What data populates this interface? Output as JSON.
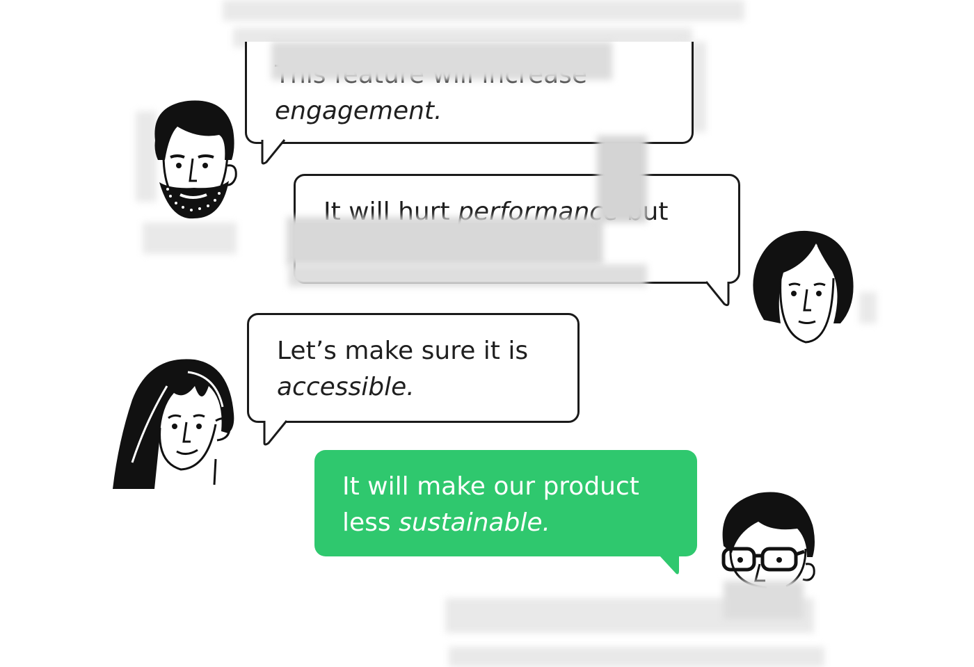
{
  "messages": [
    {
      "id": "m1",
      "line1": "This feature will increase",
      "line2_italic": "engagement."
    },
    {
      "id": "m2",
      "line1_plain": "It will hurt ",
      "line1_italic": "performance",
      "line1_end": " but"
    },
    {
      "id": "m3",
      "line1": "Let’s make sure it is",
      "line2_italic": "accessible."
    },
    {
      "id": "m4",
      "line1": "It will make our product",
      "line2_plain": "less ",
      "line2_italic": "sustainable."
    }
  ],
  "colors": {
    "accent_green": "#2fc86e",
    "outline": "#1a1a1a",
    "background": "#ffffff"
  },
  "avatars": [
    "bearded-man-icon",
    "short-hair-woman-icon",
    "long-hair-woman-icon",
    "glasses-man-icon"
  ]
}
